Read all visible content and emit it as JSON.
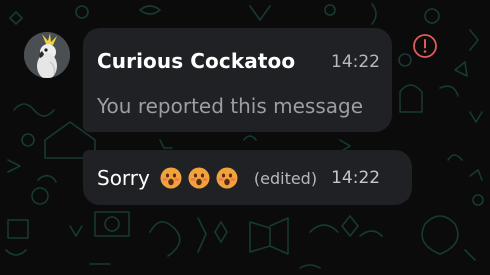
{
  "messages": [
    {
      "sender": "Curious Cockatoo",
      "time": "14:22",
      "body": "You reported this message",
      "avatar_icon": "cockatoo-avatar"
    },
    {
      "text": "Sorry",
      "emojis": [
        "face-with-open-mouth",
        "face-with-open-mouth",
        "face-with-open-mouth"
      ],
      "edited_label": "(edited)",
      "time": "14:22"
    }
  ],
  "report_icon": "alert-circle-icon",
  "colors": {
    "background": "#0b0b0c",
    "bubble": "#202124",
    "wallpaper_doodle": "#173a31",
    "alert": "#e35a5a",
    "emoji": "#f1a33b"
  }
}
